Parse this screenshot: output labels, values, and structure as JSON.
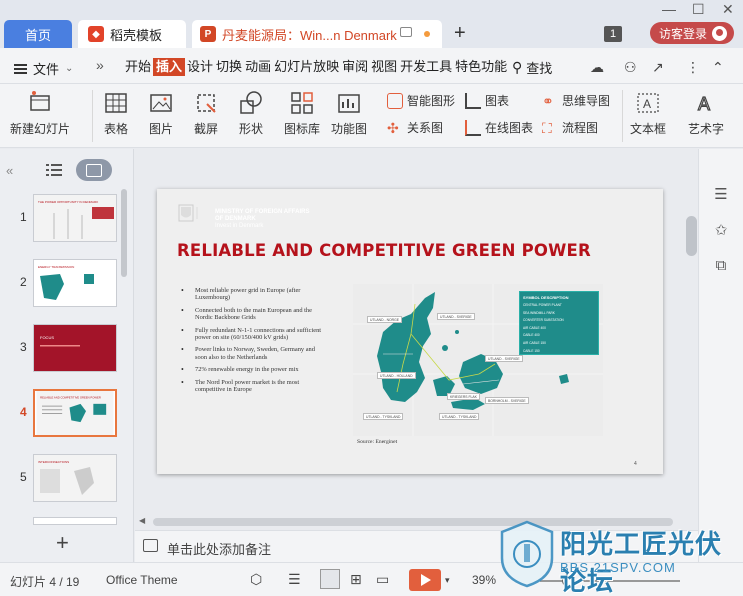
{
  "tabs": [
    {
      "label": "首页"
    },
    {
      "label": "稻壳模板"
    },
    {
      "label": "丹麦能源局：Win...n Denmark"
    }
  ],
  "window": {
    "count": "1",
    "login_label": "访客登录"
  },
  "menu": {
    "file_label": "文件",
    "items": [
      "开始",
      "插入",
      "设计",
      "切换",
      "动画",
      "幻灯片放映",
      "审阅",
      "视图",
      "开发工具",
      "特色功能"
    ],
    "active_item": "插入",
    "search_label": "查找"
  },
  "ribbon": {
    "new_slide": "新建幻灯片",
    "table": "表格",
    "picture": "图片",
    "screenshot": "截屏",
    "shape": "形状",
    "icon_lib": "图标库",
    "function_chart": "功能图",
    "smart_graphic": "智能图形",
    "relation_chart": "关系图",
    "chart": "图表",
    "online_chart": "在线图表",
    "mind_map": "思维导图",
    "flow_chart": "流程图",
    "text_box": "文本框",
    "art_text": "艺术字"
  },
  "thumbnails": [
    {
      "num": "1",
      "title": "THE POWER OPPORTUNITY IN DENMARK"
    },
    {
      "num": "2",
      "title": "ENERGY TRANSMISSION"
    },
    {
      "num": "3",
      "title": "FOCUS"
    },
    {
      "num": "4",
      "title": "RELIABLE AND COMPETITIVE GREEN POWER"
    },
    {
      "num": "5",
      "title": "INTERCONNECTIONS"
    }
  ],
  "active_slide_index": 4,
  "slide": {
    "ministry_line1": "MINISTRY OF FOREIGN AFFAIRS",
    "ministry_line2": "OF DENMARK",
    "ministry_line3": "Invest in Denmark",
    "title": "RELIABLE AND COMPETITIVE GREEN POWER",
    "bullets": [
      "Most reliable power grid in Europe (after Luxembourg)",
      "Connected both to the main European and the Nordic Backbone Grids",
      "Fully redundant N-1-1 connections and sufficient power on site (60/150/400 kV grids)",
      "Power links to Norway, Sweden, Germany and soon also to the Netherlands",
      "72% renewable energy in the power mix",
      "The Nord Pool power market is the most competitive in Europe"
    ],
    "source": "Source: Energinet",
    "page_number": "4",
    "legend_title": "SYMBOL DESCRIPTION",
    "legend_items": [
      "CENTRAL POWER PLANT",
      "SEA WINDMILL PARK",
      "CONVERTER SUBSTATION",
      "AIR CABLE 400",
      "CABLE 400",
      "AIR CABLE 150",
      "CABLE 150"
    ],
    "map_labels": [
      "UTLAND - NORGE",
      "UTLAND - SVERIGE",
      "UTLAND - SVERIGE",
      "UTLAND - HOLLAND",
      "KRIEGERS FLAK",
      "BORNHOLM - SVERIGE",
      "UTLAND - TYSKLAND",
      "UTLAND - TYSKLAND"
    ]
  },
  "notes_placeholder": "单击此处添加备注",
  "status": {
    "slide_counter": "幻灯片 4 / 19",
    "theme": "Office Theme",
    "zoom": "39%"
  },
  "watermark": {
    "text": "阳光工匠光伏论坛",
    "url": "BBS.21SPV.COM"
  },
  "colors": {
    "accent": "#d24726",
    "title_red": "#b5121b",
    "map_teal": "#1f8c8a",
    "tab_blue": "#4a7fe0"
  }
}
